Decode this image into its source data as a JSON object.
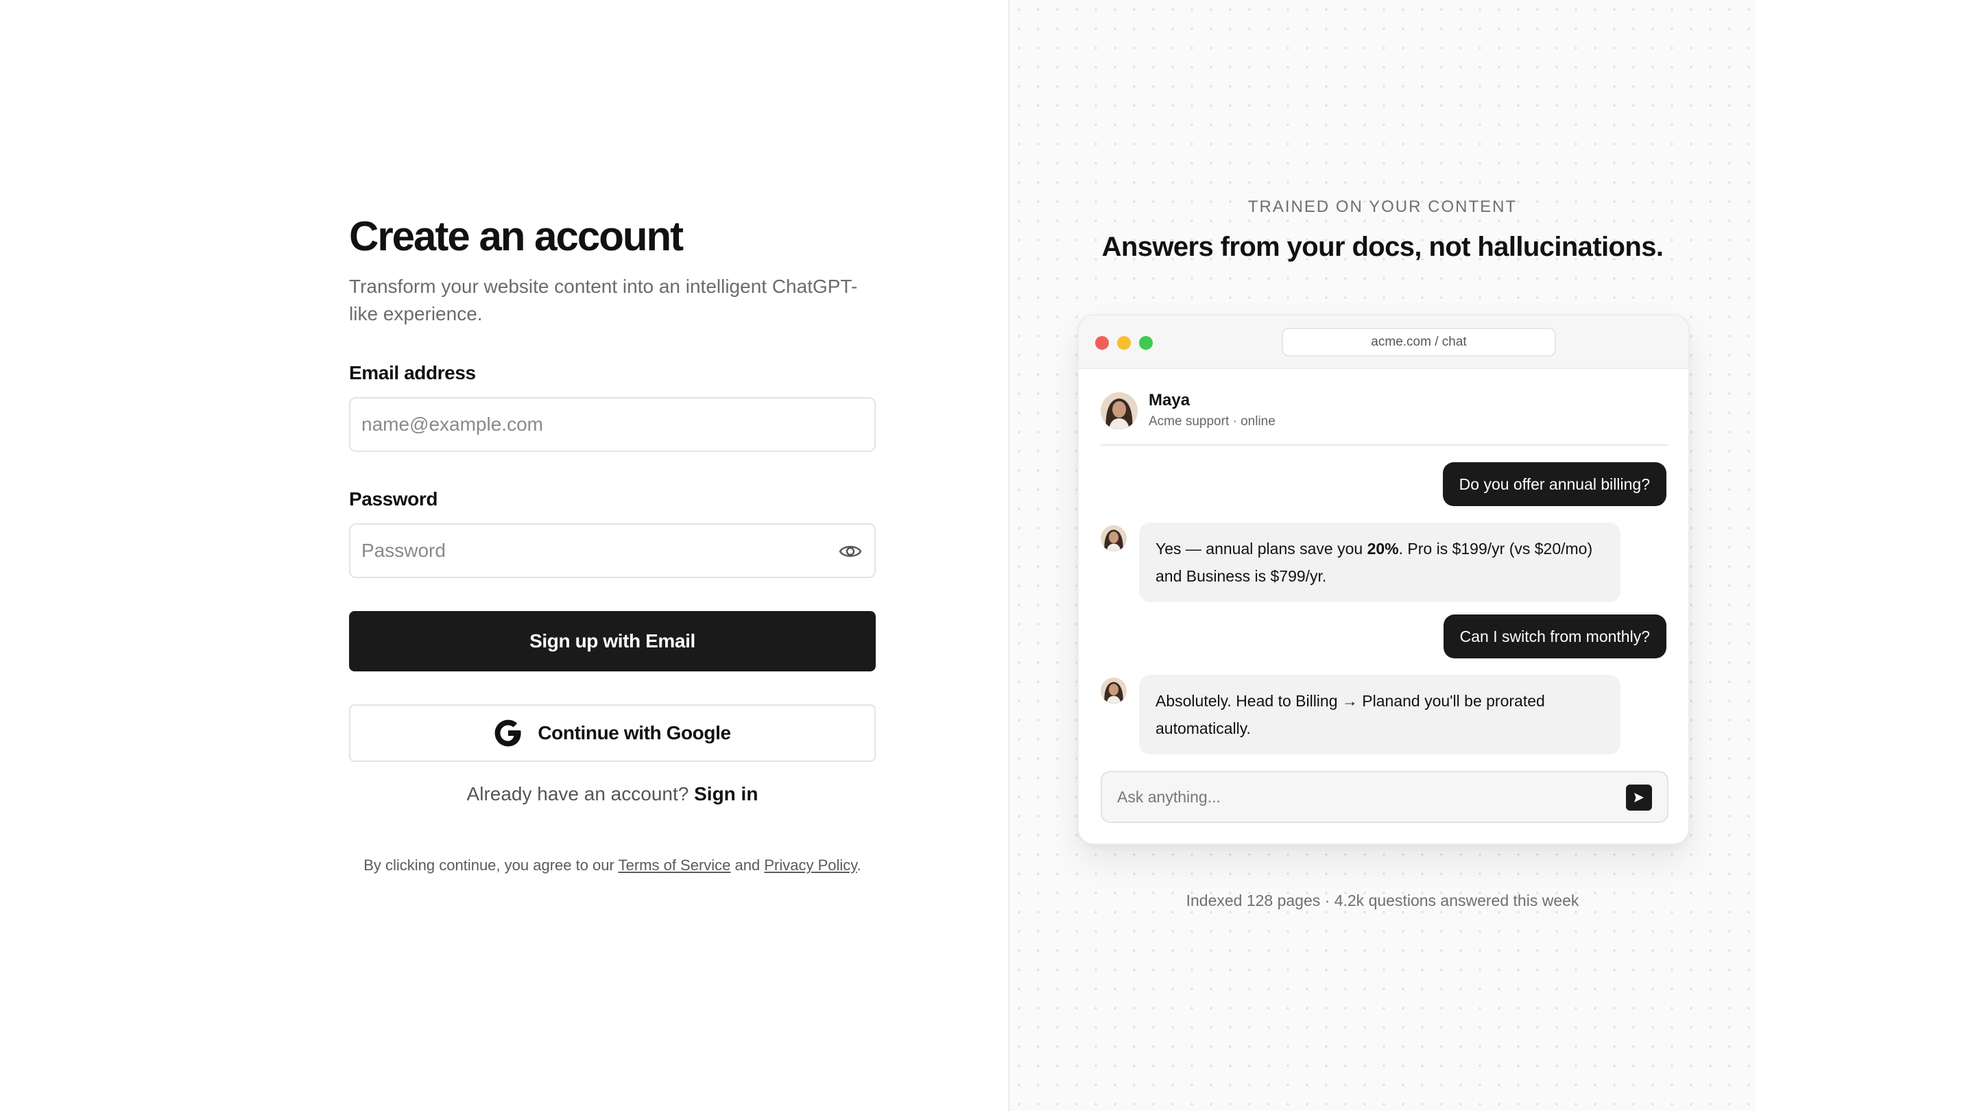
{
  "signup": {
    "title": "Create an account",
    "subtitle": "Transform your website content into an intelligent ChatGPT-like experience.",
    "email": {
      "label": "Email address",
      "placeholder": "name@example.com",
      "value": ""
    },
    "password": {
      "label": "Password",
      "placeholder": "Password",
      "value": ""
    },
    "primary_button": "Sign up with Email",
    "google_button": "Continue with Google",
    "signin_prompt": "Already have an account?",
    "signin_link": "Sign in",
    "legal": {
      "prefix": "By clicking continue, you agree to our",
      "terms": "Terms of Service",
      "and": "and",
      "privacy": "Privacy Policy",
      "suffix": "."
    }
  },
  "showcase": {
    "eyebrow": "TRAINED ON YOUR CONTENT",
    "headline": "Answers from your docs, not hallucinations.",
    "window": {
      "url": "acme.com / chat",
      "agent": {
        "name": "Maya",
        "status": "Acme support · online"
      },
      "messages": [
        {
          "role": "user",
          "text": "Do you offer annual billing?"
        },
        {
          "role": "assistant",
          "pre": "Yes — annual plans save you ",
          "bold": "20%",
          "post": ". Pro is $199/yr (vs $20/mo) and Business is $799/yr."
        },
        {
          "role": "user",
          "text": "Can I switch from monthly?"
        },
        {
          "role": "assistant",
          "text": "Absolutely. Head to Billing → Planand you'll be prorated automatically."
        }
      ],
      "composer_placeholder": "Ask anything..."
    },
    "stats": "Indexed 128 pages · 4.2k questions answered this week"
  },
  "colors": {
    "primary": "#1a1a1a",
    "dot_red": "#f25f58",
    "dot_yellow": "#f9be2f",
    "dot_green": "#3fc950"
  },
  "icons": [
    "eye-icon",
    "google-icon",
    "send-icon",
    "avatar"
  ]
}
